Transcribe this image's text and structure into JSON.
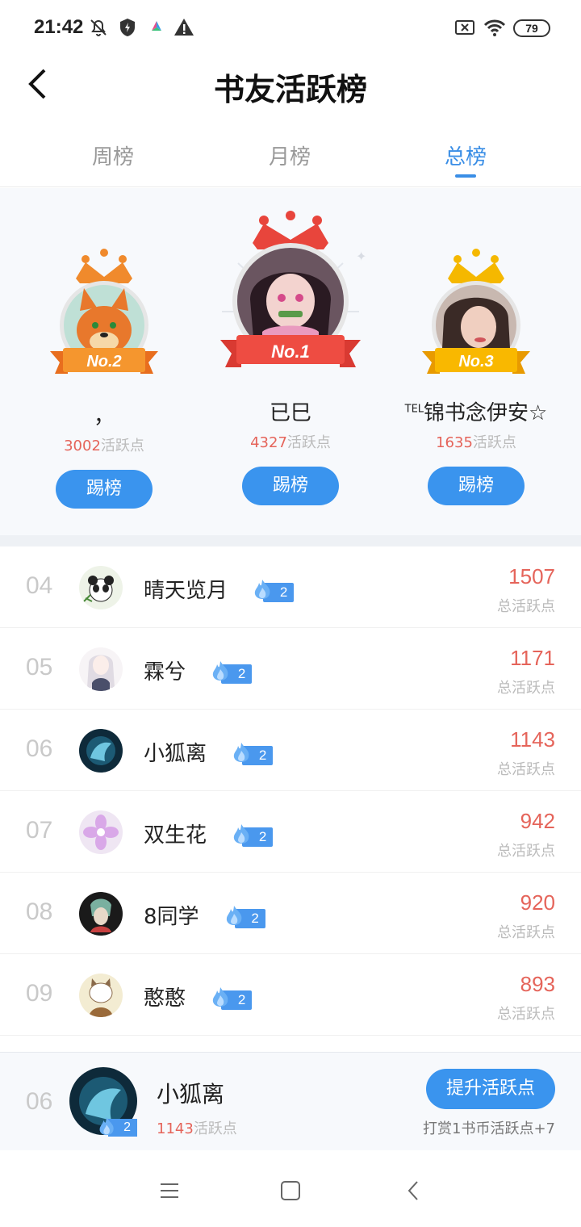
{
  "status": {
    "time": "21:42",
    "battery": "79"
  },
  "header": {
    "title": "书友活跃榜"
  },
  "tabs": [
    {
      "label": "周榜",
      "active": false
    },
    {
      "label": "月榜",
      "active": false
    },
    {
      "label": "总榜",
      "active": true
    }
  ],
  "podium": {
    "first": {
      "badge": "No.1",
      "name": "已巳",
      "points": "4327",
      "points_suffix": "活跃点",
      "button": "踢榜",
      "crown_color": "#e8453c"
    },
    "second": {
      "badge": "No.2",
      "name": "，",
      "points": "3002",
      "points_suffix": "活跃点",
      "button": "踢榜",
      "crown_color": "#f08a2c"
    },
    "third": {
      "badge": "No.3",
      "name_prefix": "TEL",
      "name": "锦书念伊安☆",
      "points": "1635",
      "points_suffix": "活跃点",
      "button": "踢榜",
      "crown_color": "#f5b800"
    }
  },
  "list": [
    {
      "rank": "04",
      "name": "晴天览月",
      "level": "2",
      "value": "1507",
      "sub": "总活跃点"
    },
    {
      "rank": "05",
      "name": "霖兮",
      "level": "2",
      "value": "1171",
      "sub": "总活跃点"
    },
    {
      "rank": "06",
      "name": "小狐离",
      "level": "2",
      "value": "1143",
      "sub": "总活跃点"
    },
    {
      "rank": "07",
      "name": "双生花",
      "level": "2",
      "value": "942",
      "sub": "总活跃点"
    },
    {
      "rank": "08",
      "name": "8同学",
      "level": "2",
      "value": "920",
      "sub": "总活跃点"
    },
    {
      "rank": "09",
      "name": "憨憨",
      "level": "2",
      "value": "893",
      "sub": "总活跃点"
    }
  ],
  "me": {
    "rank": "06",
    "name": "小狐离",
    "level": "2",
    "points": "1143",
    "points_suffix": "活跃点",
    "button": "提升活跃点",
    "hint": "打赏1书币活跃点+7"
  },
  "colors": {
    "accent": "#3a94ee",
    "points": "#e5645a"
  }
}
